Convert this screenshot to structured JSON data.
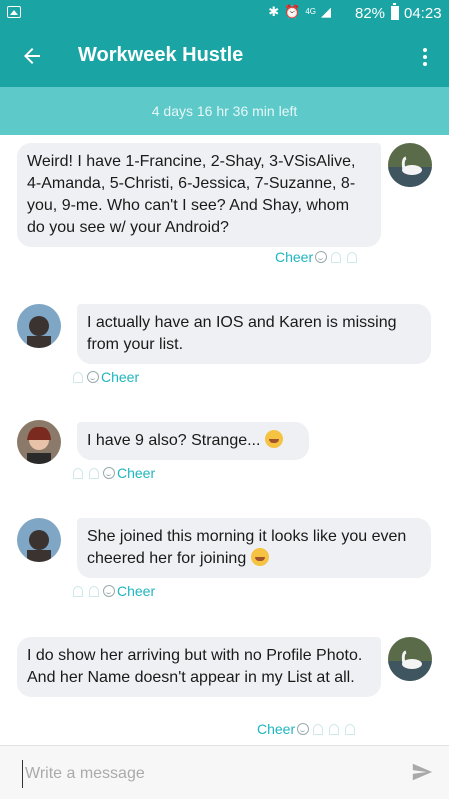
{
  "status_bar": {
    "network": "4G",
    "battery": "82%",
    "time": "04:23"
  },
  "app_bar": {
    "title": "Workweek Hustle"
  },
  "timer": {
    "label": "4 days 16 hr 36 min left"
  },
  "messages": [
    {
      "text": "Weird!  I have 1-Francine, 2-Shay, 3-VSisAlive, 4-Amanda, 5-Christi, 6-Jessica, 7-Suzanne, 8-you, 9-me.  Who can't I see?  And Shay, whom do you see w/ your Android?",
      "cheer": "Cheer"
    },
    {
      "text": "I actually have an IOS and Karen is missing from your list.",
      "cheer": "Cheer"
    },
    {
      "text": "I have 9 also? Strange...",
      "cheer": "Cheer"
    },
    {
      "text": "She joined this morning it looks like you even cheered her for joining",
      "cheer": "Cheer"
    },
    {
      "text": "I do show her arriving but with no Profile Photo.  And her Name doesn't appear in my List at all.",
      "cheer": "Cheer"
    }
  ],
  "composer": {
    "placeholder": "Write a message"
  },
  "colors": {
    "primary": "#1aa5a4",
    "timer_bar": "#5dc9c9",
    "bubble": "#eef0f3",
    "cheer": "#1fb5c1"
  }
}
